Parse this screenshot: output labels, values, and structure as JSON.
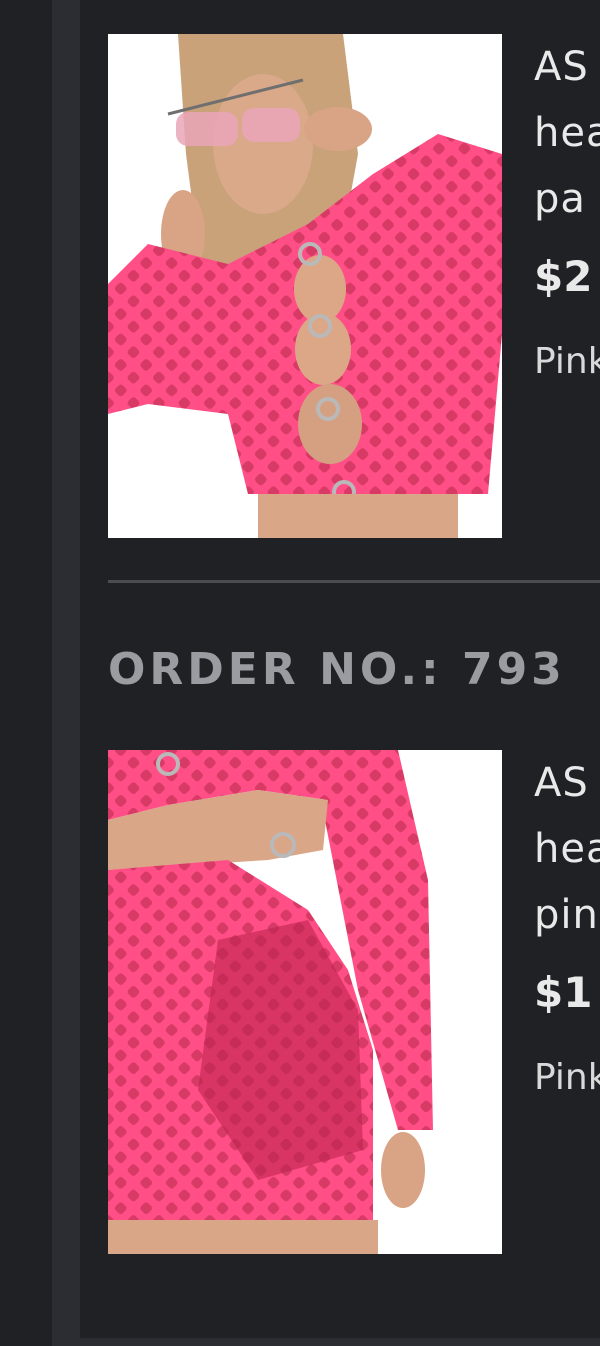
{
  "order_number_label": "ORDER NO.: 793",
  "products": [
    {
      "name_lines": [
        "AS",
        "hea",
        "pa"
      ],
      "price": "$2",
      "color": "Pink"
    },
    {
      "name_lines": [
        "AS",
        "hea",
        "pin"
      ],
      "price": "$1",
      "color": "Pink"
    }
  ],
  "colors": {
    "background": "#1f2125",
    "rail": "#2b2d32",
    "text": "#e9e9e9",
    "muted_text": "#9a9ca1",
    "mesh_pink": "#ff3f7f"
  }
}
